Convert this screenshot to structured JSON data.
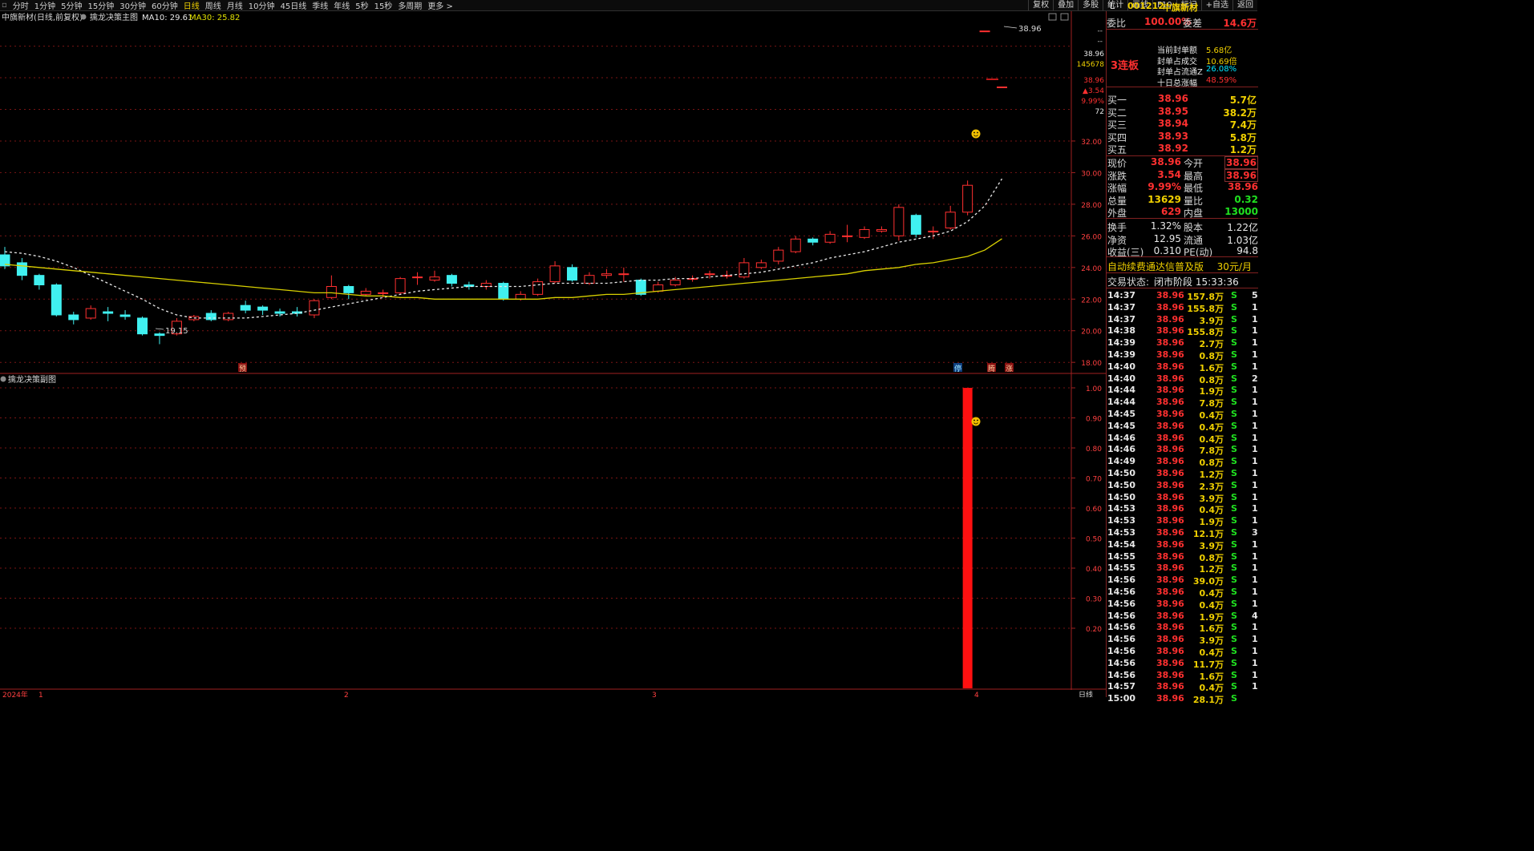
{
  "toolbar": {
    "periods": [
      "分时",
      "1分钟",
      "5分钟",
      "15分钟",
      "30分钟",
      "60分钟",
      "日线",
      "周线",
      "月线",
      "10分钟",
      "45日线",
      "季线",
      "年线",
      "5秒",
      "15秒",
      "多周期",
      "更多 >"
    ],
    "active_period": "日线",
    "tools": [
      "复权",
      "叠加",
      "多股",
      "统计",
      "画线",
      "F10",
      "标记",
      "+自选",
      "返回"
    ]
  },
  "main_chart": {
    "title": "中旗新材(日线,前复权)",
    "indicator_name": "擒龙决策主图",
    "ma10_label": "MA10: 29.61",
    "ma30_label": "MA30: 25.82",
    "high_marker": "38.96",
    "low_marker": "19.15",
    "markers": [
      "预",
      "停",
      "腾",
      "涨"
    ],
    "top_right_values": [
      "38.96",
      "145678",
      "38.96",
      "▲3.54",
      "9.99%",
      "72"
    ],
    "dashes": [
      "--",
      "--"
    ]
  },
  "sub_chart": {
    "title": "擒龙决策副图"
  },
  "bottom_axis": {
    "labels": [
      "2024年",
      "1",
      "2",
      "3",
      "4"
    ],
    "period_label": "日线"
  },
  "chart_data": [
    {
      "type": "candlestick",
      "series_names": [
        "MA10",
        "MA30"
      ],
      "y_ticks": [
        18.0,
        20.0,
        22.0,
        24.0,
        26.0,
        28.0,
        30.0,
        32.0,
        38.96
      ],
      "y_tick_labels": [
        "18.00",
        "20.00",
        "22.00",
        "24.00",
        "26.00",
        "28.00",
        "30.00",
        "32.00"
      ],
      "ylim": [
        17.3,
        39.5
      ],
      "candles": [
        {
          "o": 24.8,
          "c": 24.1,
          "h": 25.3,
          "l": 23.9
        },
        {
          "o": 24.3,
          "c": 23.5,
          "h": 24.6,
          "l": 23.2
        },
        {
          "o": 23.5,
          "c": 22.9,
          "h": 23.6,
          "l": 22.6
        },
        {
          "o": 22.9,
          "c": 21.0,
          "h": 23.0,
          "l": 20.9
        },
        {
          "o": 21.0,
          "c": 20.7,
          "h": 21.2,
          "l": 20.4
        },
        {
          "o": 20.8,
          "c": 21.4,
          "h": 21.6,
          "l": 20.7
        },
        {
          "o": 21.2,
          "c": 21.1,
          "h": 21.5,
          "l": 20.6
        },
        {
          "o": 21.0,
          "c": 20.9,
          "h": 21.3,
          "l": 20.7
        },
        {
          "o": 20.8,
          "c": 19.8,
          "h": 20.9,
          "l": 19.7
        },
        {
          "o": 19.8,
          "c": 19.7,
          "h": 19.9,
          "l": 19.15
        },
        {
          "o": 19.8,
          "c": 20.6,
          "h": 20.8,
          "l": 19.7
        },
        {
          "o": 20.7,
          "c": 20.9,
          "h": 21.0,
          "l": 20.6
        },
        {
          "o": 21.1,
          "c": 20.7,
          "h": 21.3,
          "l": 20.6
        },
        {
          "o": 20.7,
          "c": 21.1,
          "h": 21.2,
          "l": 20.6
        },
        {
          "o": 21.6,
          "c": 21.3,
          "h": 21.9,
          "l": 21.1
        },
        {
          "o": 21.5,
          "c": 21.3,
          "h": 21.6,
          "l": 21.0
        },
        {
          "o": 21.2,
          "c": 21.1,
          "h": 21.4,
          "l": 20.9
        },
        {
          "o": 21.2,
          "c": 21.1,
          "h": 21.5,
          "l": 20.9
        },
        {
          "o": 21.0,
          "c": 21.9,
          "h": 22.0,
          "l": 20.8
        },
        {
          "o": 22.1,
          "c": 22.8,
          "h": 23.5,
          "l": 22.0
        },
        {
          "o": 22.8,
          "c": 22.4,
          "h": 22.9,
          "l": 22.0
        },
        {
          "o": 22.3,
          "c": 22.5,
          "h": 22.7,
          "l": 22.2
        },
        {
          "o": 22.4,
          "c": 22.4,
          "h": 22.6,
          "l": 22.1
        },
        {
          "o": 22.4,
          "c": 23.3,
          "h": 23.4,
          "l": 22.3
        },
        {
          "o": 23.4,
          "c": 23.4,
          "h": 23.7,
          "l": 22.9
        },
        {
          "o": 23.2,
          "c": 23.4,
          "h": 23.8,
          "l": 23.1
        },
        {
          "o": 23.5,
          "c": 23.0,
          "h": 23.6,
          "l": 22.8
        },
        {
          "o": 22.9,
          "c": 22.8,
          "h": 23.1,
          "l": 22.6
        },
        {
          "o": 22.8,
          "c": 23.0,
          "h": 23.2,
          "l": 22.6
        },
        {
          "o": 23.0,
          "c": 22.0,
          "h": 23.1,
          "l": 21.9
        },
        {
          "o": 22.0,
          "c": 22.3,
          "h": 22.5,
          "l": 21.9
        },
        {
          "o": 22.3,
          "c": 23.1,
          "h": 23.3,
          "l": 22.2
        },
        {
          "o": 23.1,
          "c": 24.1,
          "h": 24.4,
          "l": 23.0
        },
        {
          "o": 24.0,
          "c": 23.2,
          "h": 24.2,
          "l": 23.1
        },
        {
          "o": 23.0,
          "c": 23.5,
          "h": 23.7,
          "l": 22.9
        },
        {
          "o": 23.5,
          "c": 23.6,
          "h": 23.9,
          "l": 23.3
        },
        {
          "o": 23.6,
          "c": 23.6,
          "h": 24.0,
          "l": 23.1
        },
        {
          "o": 23.2,
          "c": 22.3,
          "h": 23.3,
          "l": 22.2
        },
        {
          "o": 22.5,
          "c": 22.9,
          "h": 23.1,
          "l": 22.4
        },
        {
          "o": 22.9,
          "c": 23.2,
          "h": 23.4,
          "l": 22.8
        },
        {
          "o": 23.3,
          "c": 23.3,
          "h": 23.5,
          "l": 23.1
        },
        {
          "o": 23.6,
          "c": 23.6,
          "h": 23.8,
          "l": 23.3
        },
        {
          "o": 23.5,
          "c": 23.5,
          "h": 23.8,
          "l": 23.3
        },
        {
          "o": 23.4,
          "c": 24.3,
          "h": 24.6,
          "l": 23.3
        },
        {
          "o": 24.0,
          "c": 24.3,
          "h": 24.5,
          "l": 23.9
        },
        {
          "o": 24.4,
          "c": 25.1,
          "h": 25.3,
          "l": 24.2
        },
        {
          "o": 25.0,
          "c": 25.8,
          "h": 26.0,
          "l": 24.9
        },
        {
          "o": 25.8,
          "c": 25.6,
          "h": 25.9,
          "l": 25.4
        },
        {
          "o": 25.6,
          "c": 26.1,
          "h": 26.3,
          "l": 25.5
        },
        {
          "o": 26.0,
          "c": 26.0,
          "h": 26.7,
          "l": 25.6
        },
        {
          "o": 25.9,
          "c": 26.4,
          "h": 26.6,
          "l": 25.8
        },
        {
          "o": 26.3,
          "c": 26.4,
          "h": 26.6,
          "l": 26.2
        },
        {
          "o": 26.0,
          "c": 27.8,
          "h": 28.0,
          "l": 25.7
        },
        {
          "o": 27.3,
          "c": 26.1,
          "h": 27.4,
          "l": 25.9
        },
        {
          "o": 26.3,
          "c": 26.3,
          "h": 26.6,
          "l": 25.8
        },
        {
          "o": 26.5,
          "c": 27.5,
          "h": 27.9,
          "l": 26.4
        },
        {
          "o": 27.5,
          "c": 29.2,
          "h": 29.5,
          "l": 27.3
        },
        {
          "o": 38.96,
          "c": 38.96,
          "h": 38.96,
          "l": 38.96
        },
        {
          "o": 35.42,
          "c": 35.42,
          "h": 35.42,
          "l": 35.42
        }
      ],
      "ma10": [
        25.0,
        24.9,
        24.7,
        24.4,
        24.0,
        23.5,
        23.0,
        22.5,
        22.0,
        21.4,
        21.0,
        20.8,
        20.8,
        20.8,
        20.8,
        20.9,
        21.0,
        21.1,
        21.3,
        21.5,
        21.7,
        21.9,
        22.1,
        22.3,
        22.5,
        22.6,
        22.7,
        22.8,
        22.8,
        22.8,
        22.8,
        22.9,
        23.0,
        23.0,
        23.0,
        23.0,
        23.1,
        23.2,
        23.2,
        23.3,
        23.3,
        23.4,
        23.5,
        23.6,
        23.7,
        23.9,
        24.1,
        24.3,
        24.6,
        24.8,
        25.0,
        25.3,
        25.6,
        25.8,
        26.0,
        26.3,
        26.9,
        27.9,
        29.61
      ],
      "ma30": [
        24.2,
        24.1,
        24.0,
        23.9,
        23.8,
        23.7,
        23.6,
        23.5,
        23.4,
        23.3,
        23.2,
        23.1,
        23.0,
        22.9,
        22.8,
        22.7,
        22.6,
        22.5,
        22.4,
        22.4,
        22.3,
        22.2,
        22.2,
        22.1,
        22.1,
        22.0,
        22.0,
        22.0,
        22.0,
        22.0,
        22.0,
        22.0,
        22.1,
        22.1,
        22.2,
        22.3,
        22.3,
        22.4,
        22.5,
        22.6,
        22.7,
        22.8,
        22.9,
        23.0,
        23.1,
        23.2,
        23.3,
        23.4,
        23.5,
        23.6,
        23.8,
        23.9,
        24.0,
        24.2,
        24.3,
        24.5,
        24.7,
        25.1,
        25.82
      ]
    },
    {
      "type": "bar",
      "y_tick_labels": [
        "1.00",
        "0.90",
        "0.80",
        "0.70",
        "0.60",
        "0.50",
        "0.40",
        "0.30",
        "0.20"
      ],
      "ylim": [
        0,
        1.0
      ],
      "bars": [
        {
          "index": 56,
          "value": 1.0
        }
      ]
    }
  ],
  "right_panel": {
    "header_letter": "L",
    "code": "001212",
    "name": "中旗新材",
    "weibi_label": "委比",
    "weibi_value": "100.00%",
    "weicha_label": "委差",
    "weicha_value": "14.6万",
    "streak": "3连板",
    "stats": [
      {
        "label": "当前封单额",
        "value": "5.68亿"
      },
      {
        "label": "封单占成交",
        "value": "10.69倍"
      },
      {
        "label": "封单占流通Z",
        "value": "26.08%"
      },
      {
        "label": "十日总涨幅",
        "value": "48.59%"
      }
    ],
    "bids": [
      {
        "label": "买一",
        "price": "38.96",
        "vol": "5.7亿"
      },
      {
        "label": "买二",
        "price": "38.95",
        "vol": "38.2万"
      },
      {
        "label": "买三",
        "price": "38.94",
        "vol": "7.4万"
      },
      {
        "label": "买四",
        "price": "38.93",
        "vol": "5.8万"
      },
      {
        "label": "买五",
        "price": "38.92",
        "vol": "1.2万"
      }
    ],
    "quote": [
      {
        "l1": "现价",
        "v1": "38.96",
        "l2": "今开",
        "v2": "38.96"
      },
      {
        "l1": "涨跌",
        "v1": "3.54",
        "l2": "最高",
        "v2": "38.96"
      },
      {
        "l1": "涨幅",
        "v1": "9.99%",
        "l2": "最低",
        "v2": "38.96"
      },
      {
        "l1": "总量",
        "v1": "13629",
        "l2": "量比",
        "v2": "0.32"
      },
      {
        "l1": "外盘",
        "v1": "629",
        "l2": "内盘",
        "v2": "13000"
      }
    ],
    "fund": [
      {
        "l1": "换手",
        "v1": "1.32%",
        "l2": "股本",
        "v2": "1.22亿"
      },
      {
        "l1": "净资",
        "v1": "12.95",
        "l2": "流通",
        "v2": "1.03亿"
      },
      {
        "l1": "收益(三)",
        "v1": "0.310",
        "l2": "PE(动)",
        "v2": "94.8"
      }
    ],
    "ad_text": "自动续费通达信普及版",
    "ad_price": "30元/月",
    "status_label": "交易状态:",
    "status_value": "闭市阶段 15:33:36",
    "ticks": [
      [
        "14:37",
        "38.96",
        "157.8万",
        "S",
        "5"
      ],
      [
        "14:37",
        "38.96",
        "155.8万",
        "S",
        "1"
      ],
      [
        "14:37",
        "38.96",
        "3.9万",
        "S",
        "1"
      ],
      [
        "14:38",
        "38.96",
        "155.8万",
        "S",
        "1"
      ],
      [
        "14:39",
        "38.96",
        "2.7万",
        "S",
        "1"
      ],
      [
        "14:39",
        "38.96",
        "0.8万",
        "S",
        "1"
      ],
      [
        "14:40",
        "38.96",
        "1.6万",
        "S",
        "1"
      ],
      [
        "14:40",
        "38.96",
        "0.8万",
        "S",
        "2"
      ],
      [
        "14:44",
        "38.96",
        "1.9万",
        "S",
        "1"
      ],
      [
        "14:44",
        "38.96",
        "7.8万",
        "S",
        "1"
      ],
      [
        "14:45",
        "38.96",
        "0.4万",
        "S",
        "1"
      ],
      [
        "14:45",
        "38.96",
        "0.4万",
        "S",
        "1"
      ],
      [
        "14:46",
        "38.96",
        "0.4万",
        "S",
        "1"
      ],
      [
        "14:46",
        "38.96",
        "7.8万",
        "S",
        "1"
      ],
      [
        "14:49",
        "38.96",
        "0.8万",
        "S",
        "1"
      ],
      [
        "14:50",
        "38.96",
        "1.2万",
        "S",
        "1"
      ],
      [
        "14:50",
        "38.96",
        "2.3万",
        "S",
        "1"
      ],
      [
        "14:50",
        "38.96",
        "3.9万",
        "S",
        "1"
      ],
      [
        "14:53",
        "38.96",
        "0.4万",
        "S",
        "1"
      ],
      [
        "14:53",
        "38.96",
        "1.9万",
        "S",
        "1"
      ],
      [
        "14:53",
        "38.96",
        "12.1万",
        "S",
        "3"
      ],
      [
        "14:54",
        "38.96",
        "3.9万",
        "S",
        "1"
      ],
      [
        "14:55",
        "38.96",
        "0.8万",
        "S",
        "1"
      ],
      [
        "14:55",
        "38.96",
        "1.2万",
        "S",
        "1"
      ],
      [
        "14:56",
        "38.96",
        "39.0万",
        "S",
        "1"
      ],
      [
        "14:56",
        "38.96",
        "0.4万",
        "S",
        "1"
      ],
      [
        "14:56",
        "38.96",
        "0.4万",
        "S",
        "1"
      ],
      [
        "14:56",
        "38.96",
        "1.9万",
        "S",
        "4"
      ],
      [
        "14:56",
        "38.96",
        "1.6万",
        "S",
        "1"
      ],
      [
        "14:56",
        "38.96",
        "3.9万",
        "S",
        "1"
      ],
      [
        "14:56",
        "38.96",
        "0.4万",
        "S",
        "1"
      ],
      [
        "14:56",
        "38.96",
        "11.7万",
        "S",
        "1"
      ],
      [
        "14:56",
        "38.96",
        "1.6万",
        "S",
        "1"
      ],
      [
        "14:57",
        "38.96",
        "0.4万",
        "S",
        "1"
      ],
      [
        "15:00",
        "38.96",
        "28.1万",
        "S",
        ""
      ]
    ]
  }
}
